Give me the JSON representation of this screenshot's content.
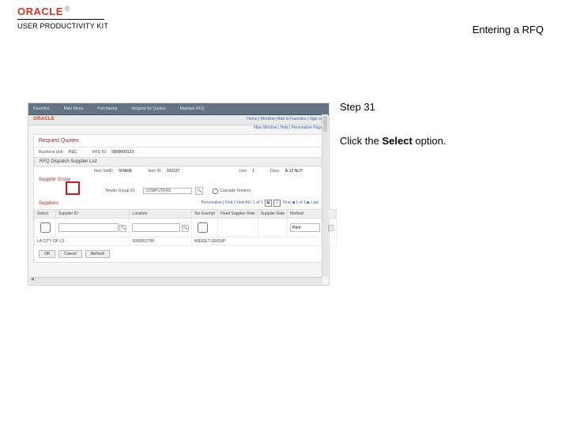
{
  "header": {
    "brand": "ORACLE",
    "tm": "®",
    "upk": "USER PRODUCTIVITY KIT",
    "title": "Entering a RFQ"
  },
  "side": {
    "step": "Step 31",
    "inst_pre": "Click the ",
    "inst_bold": "Select",
    "inst_post": " option."
  },
  "app": {
    "menubar": [
      "Favorites",
      "Main Menu",
      "Purchasing",
      "Request for Quotes",
      "Maintain RFQ"
    ],
    "brand": "ORACLE",
    "right_links": "Home | Worklist | Add to Favorites | Sign out",
    "crumb": "New Window | Help | Personalize Page",
    "page_title": "Request Quotes",
    "meta": {
      "bu_label": "Business Unit:",
      "bu": "FSC",
      "rfq_label": "RFQ ID:",
      "rfq": "0000000123"
    },
    "box_title": "RFQ Dispatch Supplier List",
    "supplier_group": "Supplier Group",
    "line2": {
      "itemset_label": "Item SetID:",
      "itemset": "SHARE",
      "itemid_label": "Item ID:",
      "itemid": "100127"
    },
    "line3": {
      "line_label": "Line:",
      "line": "1",
      "desc_label": "Desc:",
      "desc": "A-12 NUT"
    },
    "tender": {
      "label": "Tender Group ID:",
      "value": "COMPUTERS",
      "cascade": "Cascade Tenders"
    },
    "suppliers_label": "Suppliers",
    "suppliers_right": "Personalize | Find | View All | 1 of 1",
    "suppliers_nav": "First ◀ 1 of 1 ▶ Last",
    "grid_headers": [
      "Select",
      "Supplier ID",
      "Location",
      "Tax Exempt",
      "Fixed Supplier Rate",
      "Supplier Rate",
      "Method"
    ],
    "row": {
      "supplier_id": "",
      "location": "",
      "method": "Print"
    },
    "lookup_row": {
      "setid": "LA CITY OF LS",
      "id": "0000001756",
      "name": "WIDGET GROUP"
    },
    "buttons": [
      "OK",
      "Cancel",
      "Refresh"
    ],
    "sb_label": "◀"
  }
}
